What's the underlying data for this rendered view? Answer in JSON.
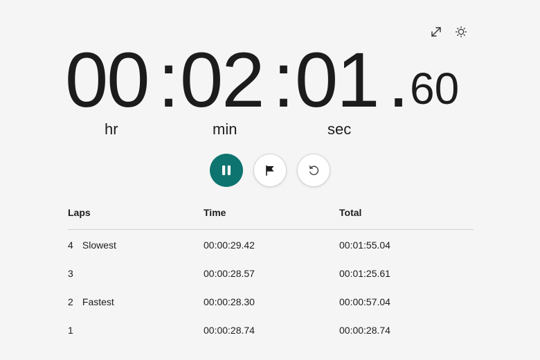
{
  "icons": {
    "expand": "expand-icon",
    "theme": "sun-icon",
    "pause": "pause-icon",
    "lap": "flag-icon",
    "reset": "reset-icon"
  },
  "colors": {
    "accent": "#0e7470",
    "background": "#f5f5f5",
    "text": "#1c1c1c"
  },
  "timer": {
    "hours": "00",
    "minutes": "02",
    "seconds": "01",
    "centiseconds": "60",
    "colon": ":",
    "dot": ".",
    "unit_hr": "hr",
    "unit_min": "min",
    "unit_sec": "sec"
  },
  "laps": {
    "headers": {
      "lap": "Laps",
      "time": "Time",
      "total": "Total"
    },
    "rows": [
      {
        "number": "4",
        "tag": "Slowest",
        "time": "00:00:29.42",
        "total": "00:01:55.04"
      },
      {
        "number": "3",
        "tag": "",
        "time": "00:00:28.57",
        "total": "00:01:25.61"
      },
      {
        "number": "2",
        "tag": "Fastest",
        "time": "00:00:28.30",
        "total": "00:00:57.04"
      },
      {
        "number": "1",
        "tag": "",
        "time": "00:00:28.74",
        "total": "00:00:28.74"
      }
    ]
  }
}
